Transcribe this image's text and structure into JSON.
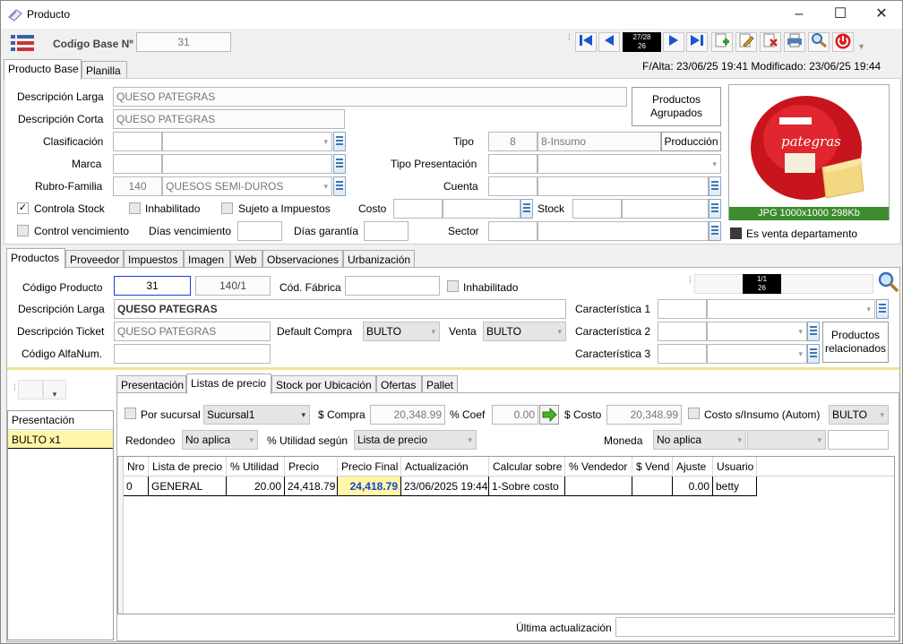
{
  "window": {
    "title": "Producto"
  },
  "header": {
    "codigo_base_label": "Codigo Base Nº",
    "codigo_base_value": "31",
    "nav_record": "27/28",
    "nav_total": "26",
    "meta": "F/Alta: 23/06/25 19:41 Modificado: 23/06/25 19:44"
  },
  "top_tabs": [
    "Producto Base",
    "Planilla"
  ],
  "base": {
    "desc_larga_label": "Descripción Larga",
    "desc_larga": "QUESO PATEGRAS",
    "desc_corta_label": "Descripción Corta",
    "desc_corta": "QUESO PATEGRAS",
    "clasificacion_label": "Clasificación",
    "marca_label": "Marca",
    "rubro_label": "Rubro-Familia",
    "rubro_code": "140",
    "rubro_name": "QUESOS SEMI-DUROS",
    "tipo_label": "Tipo",
    "tipo_code": "8",
    "tipo_name": "8-Insumo",
    "produccion_button": "Producción",
    "tipo_pres_label": "Tipo Presentación",
    "cuenta_label": "Cuenta",
    "productos_agrupados": "Productos Agrupados",
    "controla_stock": "Controla Stock",
    "inhabilitado": "Inhabilitado",
    "sujeto_impuestos": "Sujeto a Impuestos",
    "costo_label": "Costo",
    "stock_label": "Stock",
    "control_venc": "Control vencimiento",
    "dias_venc_label": "Días vencimiento",
    "dias_garantia_label": "Días garantía",
    "sector_label": "Sector",
    "image_caption": "JPG 1000x1000 298Kb",
    "es_venta_depto": "Es venta departamento",
    "image_brand": "pategras"
  },
  "product_tabs": [
    "Productos",
    "Proveedor",
    "Impuestos",
    "Imagen",
    "Web",
    "Observaciones",
    "Urbanización"
  ],
  "producto": {
    "codigo_label": "Código Producto",
    "codigo": "31",
    "codigo2": "140/1",
    "cod_fabrica_label": "Cód. Fábrica",
    "inhabilitado": "Inhabilitado",
    "nav_record": "1/1",
    "nav_total": "26",
    "desc_larga_label": "Descripción Larga",
    "desc_larga": "QUESO PATEGRAS",
    "desc_ticket_label": "Descripción Ticket",
    "desc_ticket": "QUESO PATEGRAS",
    "default_compra_label": "Default Compra",
    "default_compra": "BULTO",
    "venta_label": "Venta",
    "venta": "BULTO",
    "alfanum_label": "Código AlfaNum.",
    "car1_label": "Característica 1",
    "car2_label": "Característica 2",
    "car3_label": "Característica 3",
    "productos_relacionados": "Productos relacionados"
  },
  "presentacion": {
    "header": "Presentación",
    "item": "BULTO x1"
  },
  "inner_tabs": [
    "Presentación",
    "Listas de precio",
    "Stock por Ubicación",
    "Ofertas",
    "Pallet"
  ],
  "precios": {
    "por_sucursal": "Por sucursal",
    "sucursal": "Sucursal1",
    "compra_label": "$ Compra",
    "compra": "20,348.99",
    "coef_label": "% Coef",
    "coef": "0.00",
    "costo_label": "$ Costo",
    "costo": "20,348.99",
    "costo_insumo": "Costo s/Insumo (Autom)",
    "costo_unidad": "BULTO",
    "redondeo_label": "Redondeo",
    "redondeo": "No aplica",
    "utilidad_label": "% Utilidad según",
    "utilidad": "Lista de precio",
    "moneda_label": "Moneda",
    "moneda": "No aplica",
    "columns": [
      "Nro",
      "Lista de precio",
      "% Utilidad",
      "Precio",
      "Precio Final",
      "Actualización",
      "Calcular sobre",
      "% Vendedor",
      "$ Vend",
      "Ajuste",
      "Usuario"
    ],
    "rows": [
      [
        "0",
        "GENERAL",
        "20.00",
        "24,418.79",
        "24,418.79",
        "23/06/2025 19:44",
        "1-Sobre costo",
        "",
        "",
        "0.00",
        "betty"
      ]
    ],
    "ultima_label": "Última actualización"
  },
  "colors": {
    "accent_blue": "#1a3fd0",
    "highlight": "#fff6a8",
    "green": "#4caf25",
    "red": "#d81e1e"
  }
}
